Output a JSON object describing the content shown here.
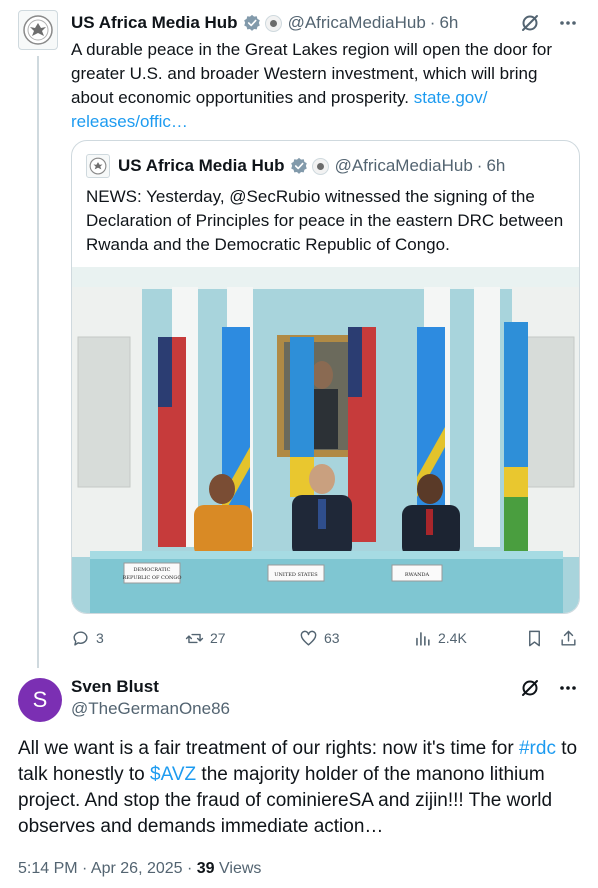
{
  "tweet1": {
    "author_name": "US Africa Media Hub",
    "handle": "@AfricaMediaHub",
    "separator": "·",
    "time": "6h",
    "text_before_link": "A durable peace in the Great Lakes region will open the door for greater U.S. and broader Western investment, which will bring about economic opportunities and prosperity. ",
    "link_text": "state.gov/ releases/offic…",
    "icons": [
      "grok-icon",
      "more-icon"
    ]
  },
  "quote": {
    "author_name": "US Africa Media Hub",
    "handle": "@AfricaMediaHub",
    "separator": "·",
    "time": "6h",
    "text": "NEWS: Yesterday, @SecRubio witnessed the signing of the Declaration of Principles for peace in the eastern DRC between Rwanda and the Democratic Republic of Congo.",
    "photo_placards": [
      "DEMOCRATIC REPUBLIC OF CONGO",
      "UNITED STATES",
      "RWANDA"
    ]
  },
  "actions": {
    "replies": "3",
    "reposts": "27",
    "likes": "63",
    "views": "2.4K"
  },
  "tweet2": {
    "avatar_letter": "S",
    "author_name": "Sven Blust",
    "handle": "@TheGermanOne86",
    "text_1": "All we want is a fair treatment of our rights: now it's time for ",
    "hashtag": "#rdc",
    "text_2": " to talk honestly to ",
    "cashtag": "$AVZ",
    "text_3": " the majority holder of the manono lithium project. And stop the fraud of cominiereSA and zijin!!! The world observes and demands immediate action…",
    "timestamp": "5:14 PM · Apr 26, 2025 · ",
    "views_count": "39",
    "views_label": " Views"
  },
  "colors": {
    "link": "#1d9bf0",
    "secondary_text": "#536471",
    "avatar_bg": "#7b2fb3",
    "verified": "#1d9bf0"
  }
}
